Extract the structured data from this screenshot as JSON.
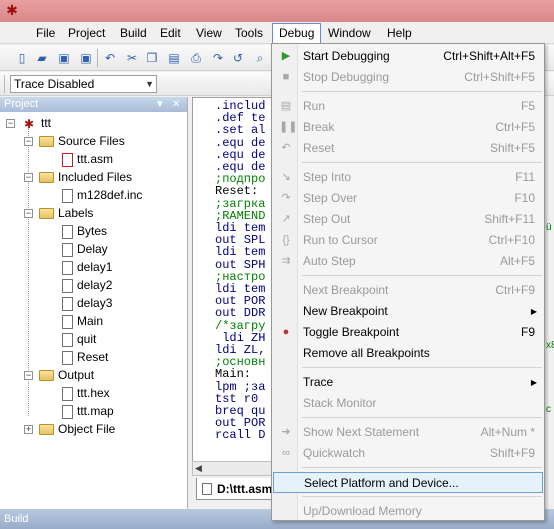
{
  "menubar": {
    "items": [
      "File",
      "Project",
      "Build",
      "Edit",
      "View",
      "Tools",
      "Debug",
      "Window",
      "Help"
    ],
    "active": "Debug"
  },
  "toolbar2": {
    "trace_select_value": "Trace Disabled"
  },
  "project_panel": {
    "title": "Project",
    "root": "ttt",
    "tree": [
      {
        "label": "Source Files",
        "kind": "folder",
        "level": 1
      },
      {
        "label": "ttt.asm",
        "kind": "file-red",
        "level": 2
      },
      {
        "label": "Included Files",
        "kind": "folder",
        "level": 1
      },
      {
        "label": "m128def.inc",
        "kind": "file",
        "level": 2
      },
      {
        "label": "Labels",
        "kind": "folder",
        "level": 1
      },
      {
        "label": "Bytes",
        "kind": "file",
        "level": 2
      },
      {
        "label": "Delay",
        "kind": "file",
        "level": 2
      },
      {
        "label": "delay1",
        "kind": "file",
        "level": 2
      },
      {
        "label": "delay2",
        "kind": "file",
        "level": 2
      },
      {
        "label": "delay3",
        "kind": "file",
        "level": 2
      },
      {
        "label": "Main",
        "kind": "file",
        "level": 2
      },
      {
        "label": "quit",
        "kind": "file",
        "level": 2
      },
      {
        "label": "Reset",
        "kind": "file",
        "level": 2
      },
      {
        "label": "Output",
        "kind": "folder",
        "level": 1
      },
      {
        "label": "ttt.hex",
        "kind": "file",
        "level": 2
      },
      {
        "label": "ttt.map",
        "kind": "file",
        "level": 2
      },
      {
        "label": "Object File",
        "kind": "folder-collapsed",
        "level": 1
      }
    ]
  },
  "editor": {
    "lines": [
      {
        "text": ".includ",
        "color": "#000080"
      },
      {
        "text": ".def te",
        "color": "#000080"
      },
      {
        "text": ".set al",
        "color": "#000080"
      },
      {
        "text": ".equ de",
        "color": "#000080"
      },
      {
        "text": ".equ de",
        "color": "#000080"
      },
      {
        "text": ".equ de",
        "color": "#000080"
      },
      {
        "text": ";подпро",
        "color": "#008000"
      },
      {
        "text": "Reset:",
        "color": "#000000"
      },
      {
        "text": ";загрка",
        "color": "#008000"
      },
      {
        "text": ";RAMEND",
        "color": "#008000"
      },
      {
        "text": "ldi tem",
        "color": "#000080"
      },
      {
        "text": "out SPL",
        "color": "#000080"
      },
      {
        "text": "ldi tem",
        "color": "#000080"
      },
      {
        "text": "out SPH",
        "color": "#000080"
      },
      {
        "text": ";настро",
        "color": "#008000"
      },
      {
        "text": "ldi tem",
        "color": "#000080"
      },
      {
        "text": "out POR",
        "color": "#000080"
      },
      {
        "text": "out DDR",
        "color": "#000080"
      },
      {
        "text": "/*загру",
        "color": "#008000"
      },
      {
        "text": " ldi ZH",
        "color": "#000080"
      },
      {
        "text": "ldi ZL,",
        "color": "#000080"
      },
      {
        "text": ";основн",
        "color": "#008000"
      },
      {
        "text": "Main:",
        "color": "#000000"
      },
      {
        "text": "lpm ;за",
        "color": "#000080"
      },
      {
        "text": "tst r0",
        "color": "#000080"
      },
      {
        "text": "breq qu",
        "color": "#000080"
      },
      {
        "text": "out POR",
        "color": "#000080"
      },
      {
        "text": "rcall D",
        "color": "#000080"
      }
    ],
    "tab_label": "D:\\ttt.asm",
    "right_peek": [
      "ü",
      "x8",
      "c"
    ]
  },
  "build_panel": {
    "title": "Build"
  },
  "debug_menu": {
    "items": [
      {
        "label": "Start Debugging",
        "shortcut": "Ctrl+Shift+Alt+F5",
        "enabled": true,
        "icon": "play-icon"
      },
      {
        "label": "Stop Debugging",
        "shortcut": "Ctrl+Shift+F5",
        "enabled": false,
        "icon": "stop-icon"
      },
      {
        "sep": true
      },
      {
        "label": "Run",
        "shortcut": "F5",
        "enabled": false,
        "icon": "run-icon"
      },
      {
        "label": "Break",
        "shortcut": "Ctrl+F5",
        "enabled": false,
        "icon": "pause-icon"
      },
      {
        "label": "Reset",
        "shortcut": "Shift+F5",
        "enabled": false,
        "icon": "reset-icon"
      },
      {
        "sep": true
      },
      {
        "label": "Step Into",
        "shortcut": "F11",
        "enabled": false,
        "icon": "step-into-icon"
      },
      {
        "label": "Step Over",
        "shortcut": "F10",
        "enabled": false,
        "icon": "step-over-icon"
      },
      {
        "label": "Step Out",
        "shortcut": "Shift+F11",
        "enabled": false,
        "icon": "step-out-icon"
      },
      {
        "label": "Run to Cursor",
        "shortcut": "Ctrl+F10",
        "enabled": false,
        "icon": "run-to-cursor-icon"
      },
      {
        "label": "Auto Step",
        "shortcut": "Alt+F5",
        "enabled": false,
        "icon": "auto-step-icon"
      },
      {
        "sep": true
      },
      {
        "label": "Next Breakpoint",
        "shortcut": "Ctrl+F9",
        "enabled": false
      },
      {
        "label": "New Breakpoint",
        "shortcut": "",
        "enabled": true,
        "submenu": true
      },
      {
        "label": "Toggle Breakpoint",
        "shortcut": "F9",
        "enabled": true,
        "icon": "breakpoint-icon"
      },
      {
        "label": "Remove all Breakpoints",
        "shortcut": "",
        "enabled": true
      },
      {
        "sep": true
      },
      {
        "label": "Trace",
        "shortcut": "",
        "enabled": true,
        "submenu": true
      },
      {
        "label": "Stack Monitor",
        "shortcut": "",
        "enabled": false
      },
      {
        "sep": true
      },
      {
        "label": "Show Next Statement",
        "shortcut": "Alt+Num *",
        "enabled": false,
        "icon": "arrow-right-icon"
      },
      {
        "label": "Quickwatch",
        "shortcut": "Shift+F9",
        "enabled": false,
        "icon": "glasses-icon"
      },
      {
        "sep": true
      },
      {
        "label": "Select Platform and Device...",
        "shortcut": "",
        "enabled": true,
        "highlight": true
      },
      {
        "sep": true
      },
      {
        "label": "Up/Download Memory",
        "shortcut": "",
        "enabled": false
      }
    ]
  },
  "colors": {
    "accent": "#6a9fd8",
    "highlight_bg": "#e5f1fb",
    "disabled_text": "#9a9a9a",
    "breakpoint": "#c03030",
    "play": "#2a9a2a"
  }
}
